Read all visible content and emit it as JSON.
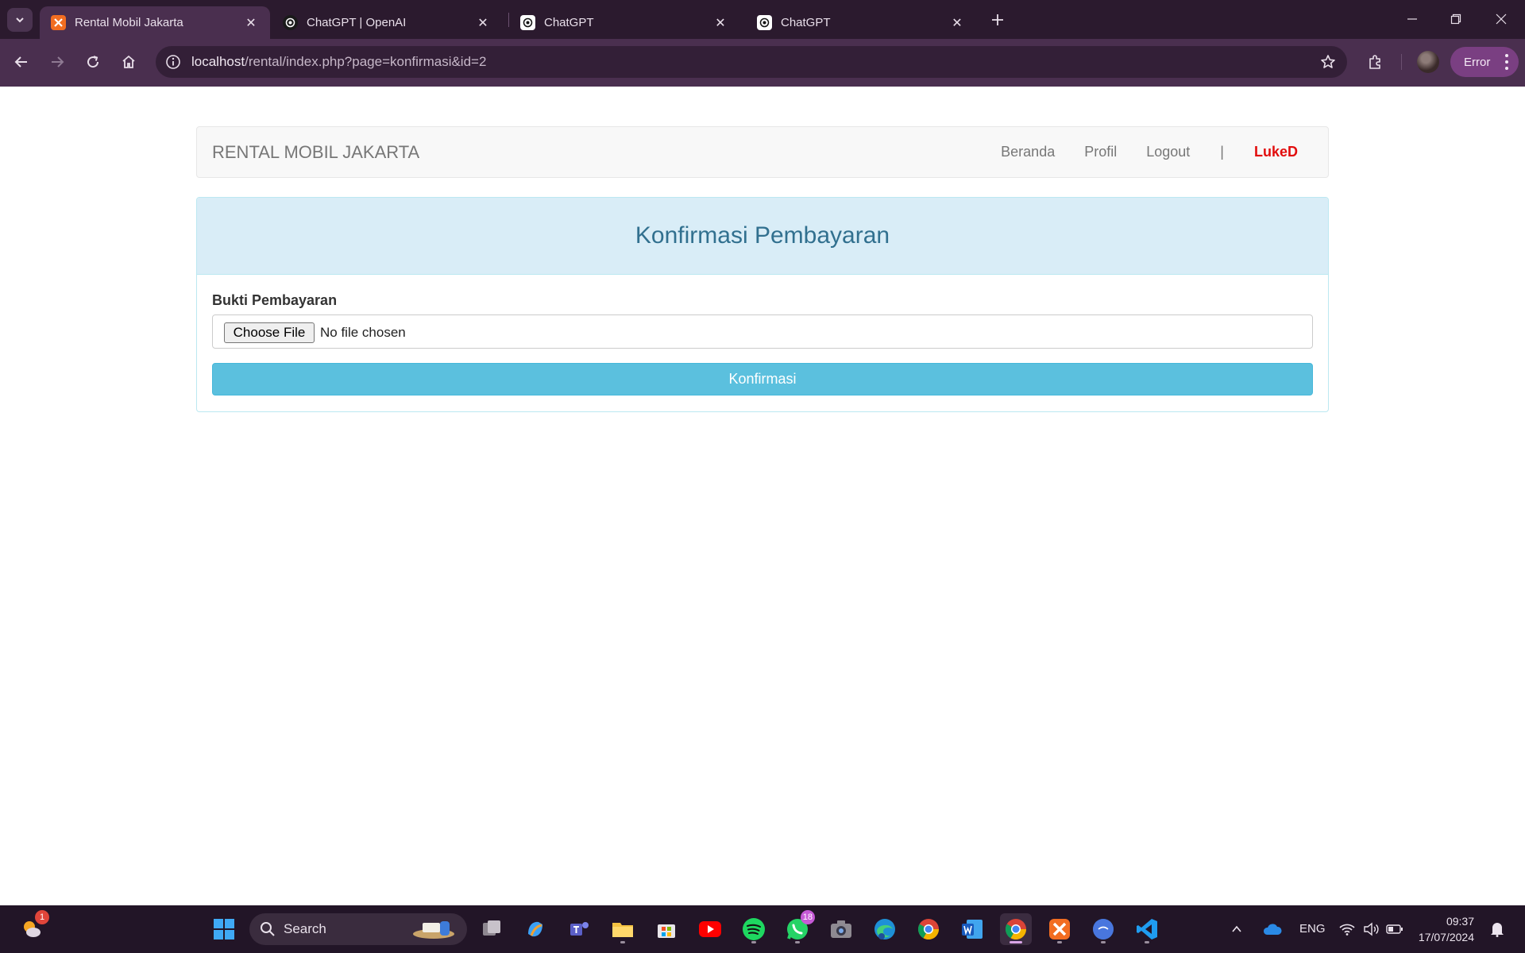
{
  "browser": {
    "tabs": [
      {
        "title": "Rental Mobil Jakarta",
        "active": true
      },
      {
        "title": "ChatGPT | OpenAI",
        "active": false
      },
      {
        "title": "ChatGPT",
        "active": false
      },
      {
        "title": "ChatGPT",
        "active": false
      }
    ],
    "url_host": "localhost",
    "url_path": "/rental/index.php?page=konfirmasi&id=2",
    "profile_button": "Error"
  },
  "navbar": {
    "brand": "RENTAL MOBIL JAKARTA",
    "links": [
      "Beranda",
      "Profil",
      "Logout"
    ],
    "separator": "|",
    "username": "LukeD"
  },
  "panel": {
    "title": "Konfirmasi Pembayaran",
    "field_label": "Bukti Pembayaran",
    "choose_file_label": "Choose File",
    "file_status": "No file chosen",
    "submit_label": "Konfirmasi"
  },
  "taskbar": {
    "search_label": "Search",
    "weather_badge": "1",
    "whatsapp_badge": "18",
    "language": "ENG",
    "time": "09:37",
    "date": "17/07/2024"
  },
  "colors": {
    "chrome_bg": "#2b1a2e",
    "toolbar_bg": "#4a2f4f",
    "panel_heading_bg": "#d9edf7",
    "panel_title": "#31708f",
    "button_info": "#5bc0de",
    "username": "#e20d0d"
  }
}
